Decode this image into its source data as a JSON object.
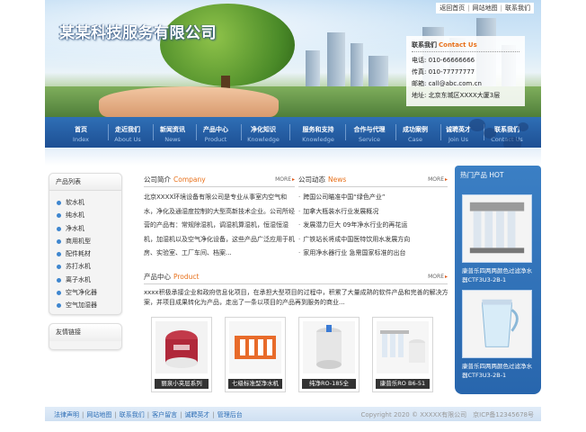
{
  "header": {
    "company_name": "某某科技服务有限公司",
    "top_links": [
      "返回首页",
      "网站地图",
      "联系我们"
    ],
    "contact": {
      "title_cn": "联系我们",
      "title_en": "Contact Us",
      "phone": "电话: 010-66666666",
      "fax": "传真: 010-77777777",
      "email": "邮箱: call@abc.com.cn",
      "address": "地址: 北京东城区XXXX大厦3层"
    }
  },
  "nav": [
    {
      "cn": "首页",
      "en": "Index"
    },
    {
      "cn": "走近我们",
      "en": "About Us"
    },
    {
      "cn": "新闻资讯",
      "en": "News"
    },
    {
      "cn": "产品中心",
      "en": "Product"
    },
    {
      "cn": "净化知识",
      "en": "Knowledge"
    },
    {
      "cn": "服务和支持",
      "en": "Knowledge"
    },
    {
      "cn": "合作与代理",
      "en": "Service"
    },
    {
      "cn": "成功案例",
      "en": "Case"
    },
    {
      "cn": "诚聘英才",
      "en": "Join Us"
    },
    {
      "cn": "联系我们",
      "en": "Contact Us"
    }
  ],
  "sidebar": {
    "categories_title": "产品列表",
    "categories": [
      "软水机",
      "纯水机",
      "净水机",
      "商用机型",
      "配件耗材",
      "苏打水机",
      "离子水机",
      "空气净化器",
      "空气加湿器"
    ],
    "links_title": "友情链接"
  },
  "about": {
    "title_cn": "公司简介",
    "title_en": "Company",
    "more": "MORE",
    "text": "北京XXXX环境设备有限公司是专业从事室内空气和水，净化及通湿度控制的大型高新技术企业。公司所经营的产品有：常规除湿机，调湿机算湿机，恒湿恒湿机，加湿机以及空气净化设备，这些产品广泛应用于机房、实验室、工厂车间、档案..."
  },
  "news": {
    "title_cn": "公司动态",
    "title_en": "News",
    "more": "MORE",
    "items": [
      "跨国公司瞄准中国“绿色产业”",
      "加拿大瓶装水行业发展概况",
      "发展潜力巨大 09年净水行业的再花运",
      "广铁站长将成中国医特饮用水发展方向",
      "家用净水器行业 急需国家标准的出台"
    ]
  },
  "products": {
    "title_cn": "产品中心",
    "title_en": "Product",
    "more": "MORE",
    "desc": "xxxx积极承接企业和政府信息化项目，在承担大型项目的过程中，积累了大量成熟的软件产品和完善的解决方案，并项目成果转化为产品，走出了一条以项目的产品再到服务的商业...",
    "items": [
      "丽泉小夹层系列",
      "七级标准型净水机",
      "纯净RO-185全",
      "康普乐RO B6-51"
    ]
  },
  "hot": {
    "title": "热门产品 HOT",
    "items": [
      "康普乐四两两颜色过滤净水器CTF3U3-2B-1",
      "康普乐四两两颜色过滤净水器CTF3U3-2B-1"
    ]
  },
  "footer": {
    "links": [
      "法律声明",
      "网站地图",
      "联系我们",
      "客户留言",
      "诚聘英才",
      "管理后台"
    ],
    "copyright": "Copyright 2020 © XXXXX有限公司　京ICP备12345678号"
  },
  "colors": {
    "nav_blue": "#1d4f94",
    "accent_orange": "#e8701a",
    "hot_blue": "#2866ad"
  }
}
